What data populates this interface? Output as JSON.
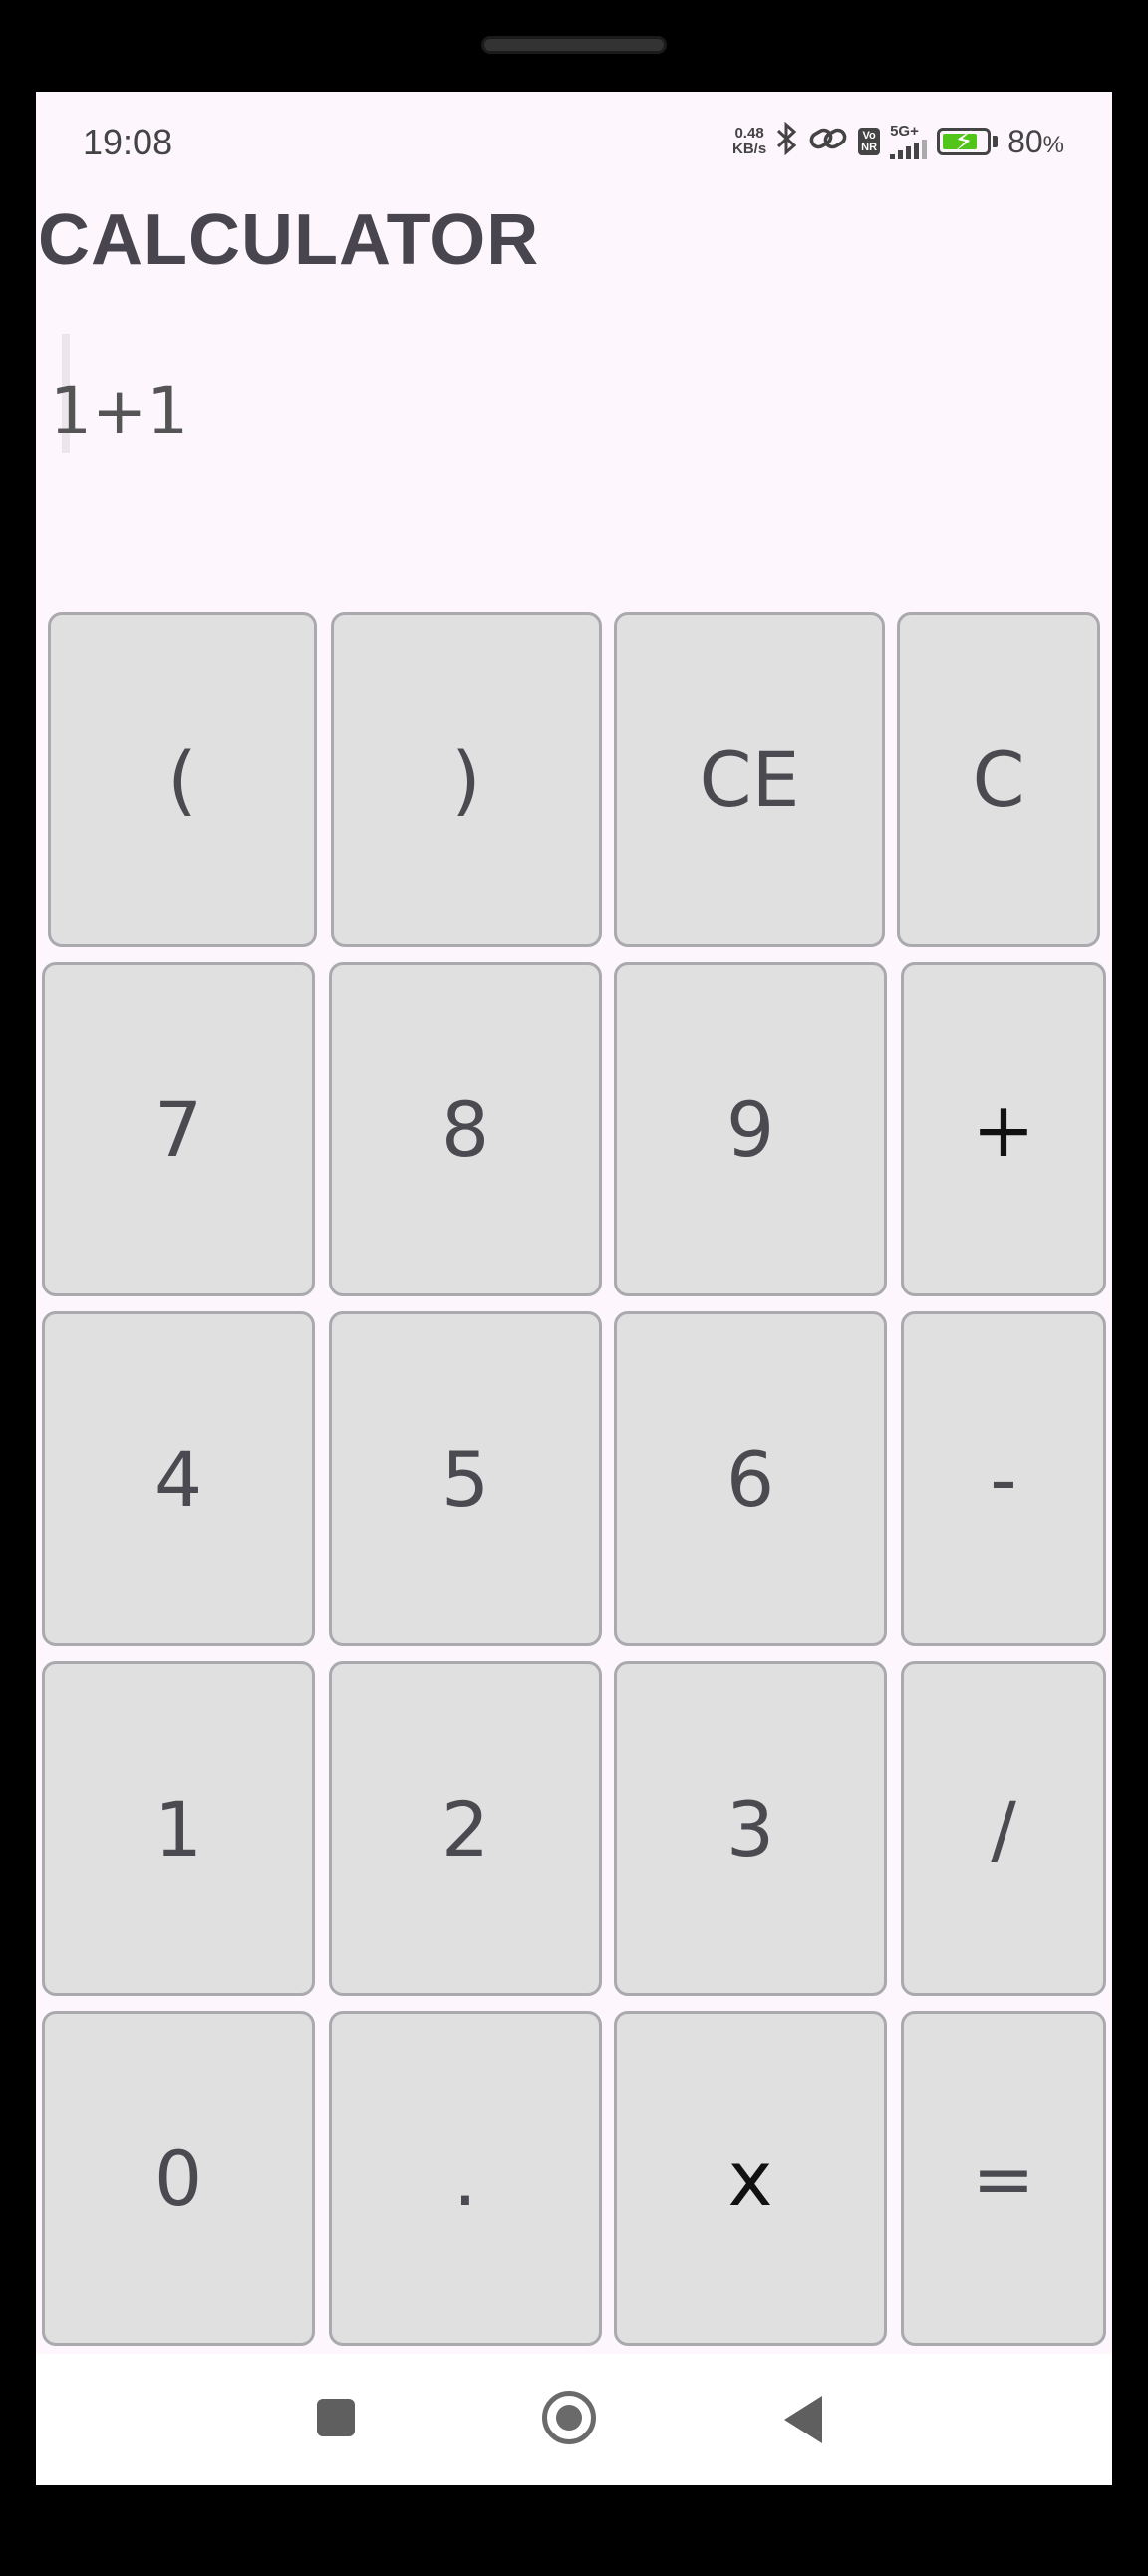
{
  "status_bar": {
    "time": "19:08",
    "net_speed": "0.48",
    "net_unit": "KB/s",
    "bluetooth_icon": "bluetooth-icon",
    "link_icon": "link-icon",
    "vonr_label_top": "Vo",
    "vonr_label_bottom": "NR",
    "network_type": "5G+",
    "battery_level": 0.8,
    "battery_text": "80",
    "battery_unit": "%",
    "battery_color": "#52c41a"
  },
  "app": {
    "title": "CALCULATOR",
    "expression": "1+1"
  },
  "keypad": {
    "rows": [
      [
        "(",
        ")",
        "CE",
        "C"
      ],
      [
        "7",
        "8",
        "9",
        "+"
      ],
      [
        "4",
        "5",
        "6",
        "-"
      ],
      [
        "1",
        "2",
        "3",
        "/"
      ],
      [
        "0",
        ".",
        "x",
        "="
      ]
    ]
  },
  "colors": {
    "screen_background": "#fdf7fd",
    "key_background": "#e0e0e0",
    "key_border": "#a9a9ae",
    "title_color": "#49454f"
  },
  "nav_bar": {
    "recents_icon": "square-icon",
    "home_icon": "circle-home-icon",
    "back_icon": "triangle-back-icon"
  }
}
